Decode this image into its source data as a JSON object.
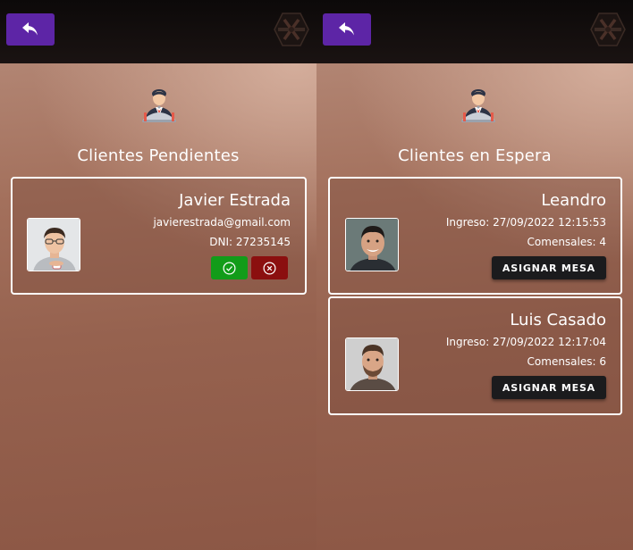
{
  "left": {
    "title": "Clientes Pendientes",
    "card": {
      "name": "Javier Estrada",
      "email": "javierestrada@gmail.com",
      "dni": "DNI: 27235145"
    },
    "back_icon": "reply-arrow-icon",
    "approve_icon": "check-circle-icon",
    "reject_icon": "x-circle-icon"
  },
  "right": {
    "title": "Clientes en Espera",
    "cards": [
      {
        "name": "Leandro",
        "ingreso": "Ingreso: 27/09/2022 12:15:53",
        "comensales": "Comensales: 4",
        "button": "ASIGNAR MESA"
      },
      {
        "name": "Luis Casado",
        "ingreso": "Ingreso: 27/09/2022 12:17:04",
        "comensales": "Comensales: 6",
        "button": "ASIGNAR MESA"
      }
    ]
  },
  "colors": {
    "back_button": "#5d25a6",
    "approve": "#129c19",
    "reject": "#8b0f0f",
    "assign": "#1b1b1d"
  }
}
